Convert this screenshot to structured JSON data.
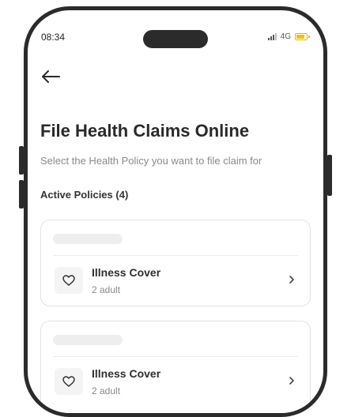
{
  "status_bar": {
    "time": "08:34",
    "network": "4G"
  },
  "header": {
    "back_icon": "arrow-left-icon"
  },
  "page": {
    "title": "File Health Claims Online",
    "subtitle": "Select the Health Policy you want to file claim for",
    "active_policies_label": "Active Policies (4)"
  },
  "policies": [
    {
      "name": "Illness Cover",
      "members": "2 adult",
      "icon": "heart-icon"
    },
    {
      "name": "Illness Cover",
      "members": "2 adult",
      "icon": "heart-icon"
    }
  ],
  "colors": {
    "title": "#2a2a2a",
    "subtitle": "#8a8a8a",
    "card_border": "#e3e3e3",
    "battery": "#f2c200",
    "frame": "#2b2b2b"
  }
}
